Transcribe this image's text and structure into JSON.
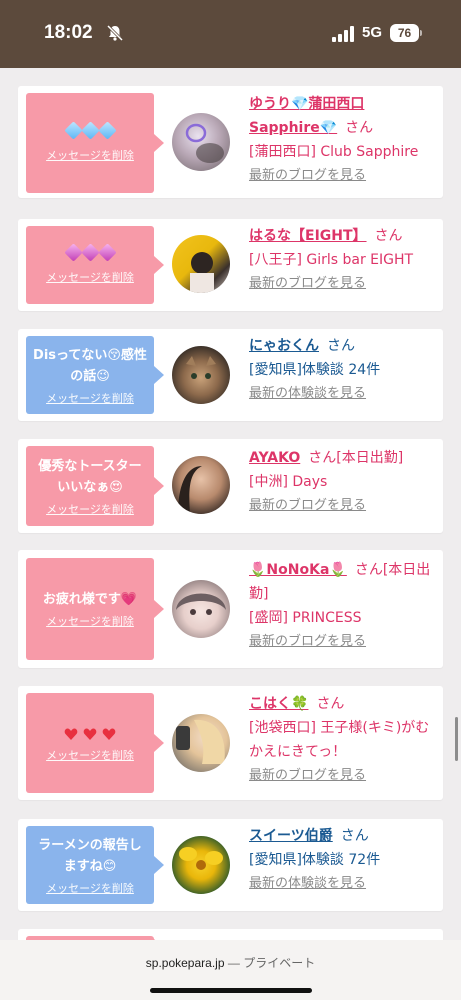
{
  "status_bar": {
    "time": "18:02",
    "network": "5G",
    "battery": "76",
    "icons": [
      "bell-slash-icon",
      "signal-icon",
      "battery-icon"
    ]
  },
  "colors": {
    "status_bg": "#5c4a3c",
    "pink_bubble": "#f79aa8",
    "blue_bubble": "#8ab4ec",
    "pink_text": "#dd3568",
    "blue_text": "#1b5a92",
    "page_bg": "#efedee"
  },
  "delete_label": "メッセージを削除",
  "san_label": "さん",
  "messages": [
    {
      "bubble_color": "pink",
      "message_icons": [
        "diamond-icon",
        "diamond-icon",
        "diamond-icon"
      ],
      "name": "ゆうり💎蒲田西口Sapphire💎",
      "san": "さん",
      "shop": "[蒲田西口] Club Sapphire",
      "link": "最新のブログを見る"
    },
    {
      "bubble_color": "pink",
      "message_icons": [
        "purple-diamond-icon",
        "purple-diamond-icon",
        "purple-diamond-icon"
      ],
      "name": "はるな【EIGHT】",
      "san": "さん",
      "shop": "[八王子] Girls bar EIGHT",
      "link": "最新のブログを見る"
    },
    {
      "bubble_color": "blue",
      "message": "Disってない😚感性の話😉",
      "name": "にゃおくん",
      "san": "さん",
      "shop": "[愛知県]体験談 24件",
      "link": "最新の体験談を見る"
    },
    {
      "bubble_color": "pink",
      "message": "優秀なトースターいいなぁ😍",
      "name": "AYAKO",
      "san": "さん[本日出勤]",
      "shop": "[中洲] Days",
      "link": "最新のブログを見る"
    },
    {
      "bubble_color": "pink",
      "message": "お疲れ様です💗",
      "name": "🌷NoNoKa🌷",
      "san": "さん[本日出勤]",
      "shop": "[盛岡] PRINCESS",
      "link": "最新のブログを見る"
    },
    {
      "bubble_color": "pink",
      "message_icons": [
        "heart-ribbon-icon",
        "heart-ribbon-icon",
        "heart-ribbon-icon"
      ],
      "name": "こはく🍀",
      "san": "さん",
      "shop": "[池袋西口] 王子様(キミ)がむかえにきてっ！",
      "link": "最新のブログを見る"
    },
    {
      "bubble_color": "blue",
      "message": "ラーメンの報告しますね😊",
      "name": "スイーツ伯爵",
      "san": "さん",
      "shop": "[愛知県]体験談 72件",
      "link": "最新の体験談を見る"
    }
  ],
  "url_bar": {
    "domain": "sp.pokepara.jp",
    "separator": " — ",
    "mode": "プライベート"
  }
}
